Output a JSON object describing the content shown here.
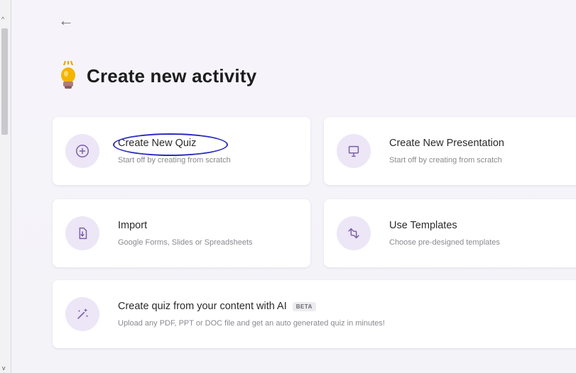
{
  "nav": {
    "back_label": "←"
  },
  "header": {
    "title": "Create new activity"
  },
  "cards": [
    {
      "name": "Create New Quiz",
      "desc": "Start off by creating from scratch",
      "icon": "plus-circle-icon"
    },
    {
      "name": "Create New Presentation",
      "desc": "Start off by creating from scratch",
      "icon": "presentation-icon"
    },
    {
      "name": "Import",
      "desc": "Google Forms, Slides or Spreadsheets",
      "icon": "import-document-icon"
    },
    {
      "name": "Use Templates",
      "desc": "Choose pre-designed templates",
      "icon": "swap-arrows-icon"
    },
    {
      "name": "Create quiz from your content with AI",
      "badge": "BETA",
      "desc": "Upload any PDF, PPT or DOC file and get an auto generated quiz in minutes!",
      "icon": "magic-wand-icon"
    }
  ],
  "colors": {
    "accent_bg": "#ece6f6",
    "icon_color": "#7b5ea7",
    "annotation_ring": "#2a2bbd"
  }
}
